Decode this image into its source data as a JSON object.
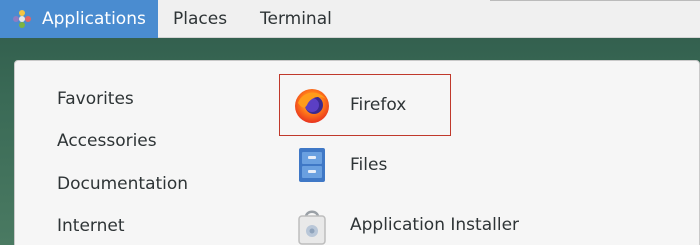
{
  "topbar": {
    "applications_label": "Applications",
    "places_label": "Places",
    "terminal_label": "Terminal"
  },
  "menu": {
    "categories": [
      {
        "label": "Favorites"
      },
      {
        "label": "Accessories"
      },
      {
        "label": "Documentation"
      },
      {
        "label": "Internet"
      }
    ],
    "apps": [
      {
        "label": "Firefox",
        "icon": "firefox-icon",
        "highlighted": true
      },
      {
        "label": "Files",
        "icon": "files-icon"
      },
      {
        "label": "Application Installer",
        "icon": "application-installer-icon"
      }
    ]
  },
  "colors": {
    "accent": "#4a8cd0",
    "highlight_border": "#c0392b"
  }
}
